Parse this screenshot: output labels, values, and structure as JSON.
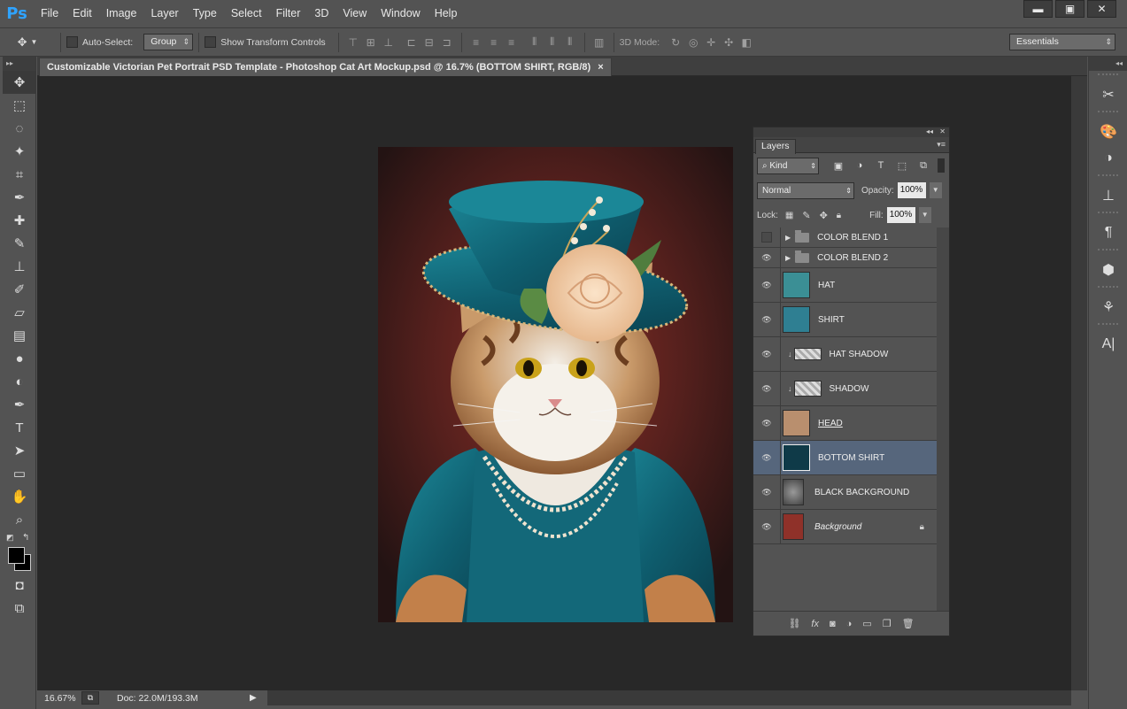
{
  "app": {
    "logo": "Ps"
  },
  "menu": [
    "File",
    "Edit",
    "Image",
    "Layer",
    "Type",
    "Select",
    "Filter",
    "3D",
    "View",
    "Window",
    "Help"
  ],
  "window_controls": {
    "minimize": "▬",
    "maximize": "▣",
    "close": "✕"
  },
  "options": {
    "auto_select_label": "Auto-Select:",
    "auto_select_value": "Group",
    "transform_label": "Show Transform Controls",
    "mode_label": "3D Mode:",
    "workspace": "Essentials"
  },
  "document": {
    "tab_title": "Customizable Victorian Pet Portrait PSD Template - Photoshop Cat Art Mockup.psd @ 16.7% (BOTTOM SHIRT, RGB/8)",
    "tab_close": "×"
  },
  "status": {
    "zoom": "16.67%",
    "doc_size": "Doc: 22.0M/193.3M"
  },
  "layers_panel": {
    "tab_label": "Layers",
    "filter_kind": "Kind",
    "blend_mode": "Normal",
    "opacity_label": "Opacity:",
    "opacity_value": "100%",
    "lock_label": "Lock:",
    "fill_label": "Fill:",
    "fill_value": "100%",
    "layers": [
      {
        "name": "COLOR BLEND 1",
        "type": "group",
        "visible": false
      },
      {
        "name": "COLOR BLEND 2",
        "type": "group",
        "visible": true
      },
      {
        "name": "HAT",
        "type": "layer",
        "visible": true,
        "thumb": "#3b8f95"
      },
      {
        "name": "SHIRT",
        "type": "layer",
        "visible": true,
        "thumb": "#2f7f92"
      },
      {
        "name": "HAT SHADOW",
        "type": "clipped",
        "visible": true,
        "thumb": "#d8d8d8"
      },
      {
        "name": "SHADOW",
        "type": "clipped",
        "visible": true,
        "thumb": "#d8d8d8"
      },
      {
        "name": "HEAD",
        "type": "layer",
        "visible": true,
        "thumb": "#b98f6e"
      },
      {
        "name": "BOTTOM SHIRT",
        "type": "layer",
        "visible": true,
        "selected": true,
        "thumb": "#0f3a48"
      },
      {
        "name": "BLACK BACKGROUND",
        "type": "layer",
        "visible": true,
        "thumb": "#777777"
      },
      {
        "name": "Background",
        "type": "background",
        "visible": true,
        "locked": true,
        "thumb": "#8f3129"
      }
    ]
  },
  "colors": {
    "accent": "#56667c",
    "logo": "#2fa3ff"
  }
}
